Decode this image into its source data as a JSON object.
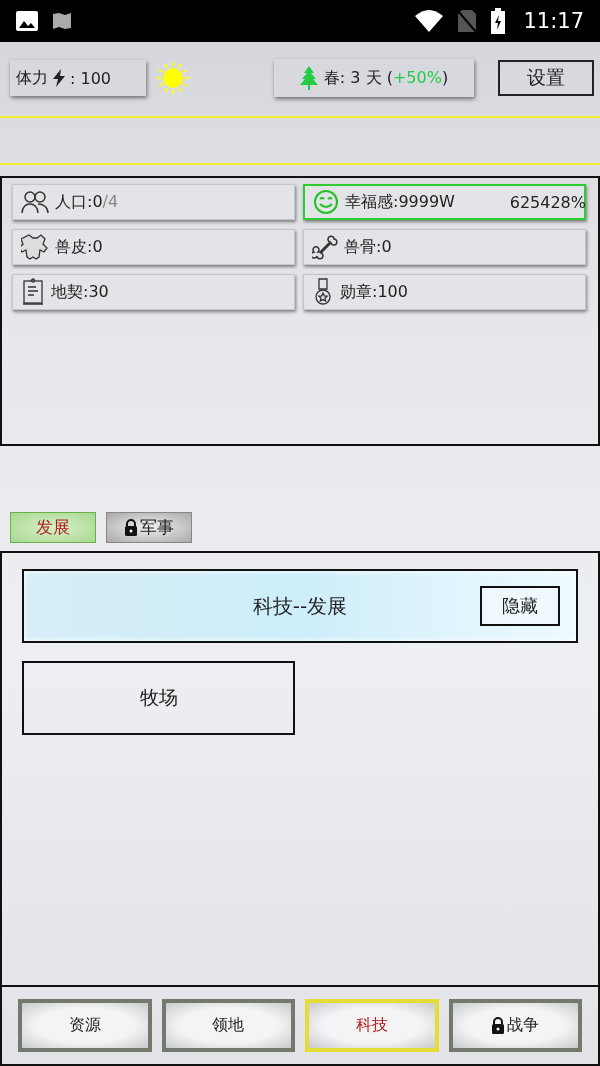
{
  "status_bar": {
    "time": "11:17"
  },
  "header": {
    "stamina": {
      "label": "体力",
      "value": ": 100"
    },
    "season": {
      "text": "春: 3 天 (",
      "bonus": "+50%",
      "suffix": ")"
    },
    "settings": "设置"
  },
  "resources": [
    {
      "kind": "people",
      "label": "人口:0",
      "max": "/4",
      "highlighted": false
    },
    {
      "kind": "smile",
      "label": "幸福感:9999W",
      "extra": "625428%",
      "highlighted": true
    },
    {
      "kind": "hide",
      "label": "兽皮:0",
      "highlighted": false
    },
    {
      "kind": "bone",
      "label": "兽骨:0",
      "highlighted": false
    },
    {
      "kind": "deed",
      "label": "地契:30",
      "highlighted": false
    },
    {
      "kind": "medal",
      "label": "勋章:100",
      "highlighted": false
    }
  ],
  "tabs": [
    {
      "label": "发展",
      "selected": true,
      "locked": false
    },
    {
      "label": "军事",
      "selected": false,
      "locked": true
    }
  ],
  "section": {
    "title": "科技--发展",
    "hide_button": "隐藏"
  },
  "items": [
    "牧场"
  ],
  "nav": [
    {
      "label": "资源",
      "selected": false,
      "locked": false
    },
    {
      "label": "领地",
      "selected": false,
      "locked": false
    },
    {
      "label": "科技",
      "selected": true,
      "locked": false
    },
    {
      "label": "战争",
      "selected": false,
      "locked": true
    }
  ]
}
